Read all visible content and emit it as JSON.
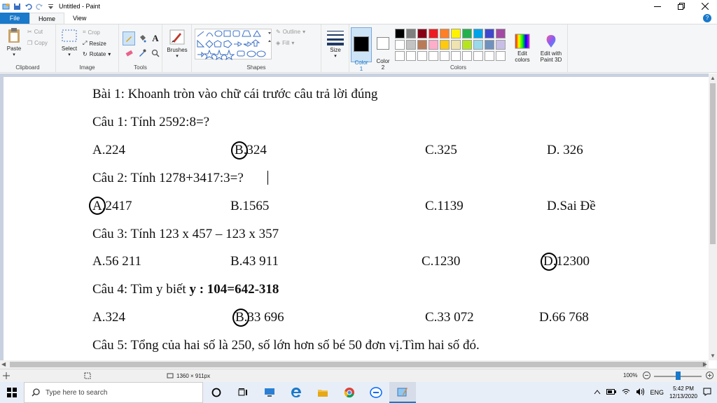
{
  "window": {
    "title": "Untitled - Paint"
  },
  "tabs": [
    "File",
    "Home",
    "View"
  ],
  "ribbon": {
    "clipboard": {
      "label": "Clipboard",
      "paste": "Paste",
      "cut": "Cut",
      "copy": "Copy"
    },
    "image": {
      "label": "Image",
      "select": "Select",
      "crop": "Crop",
      "resize": "Resize",
      "rotate": "Rotate"
    },
    "tools": {
      "label": "Tools"
    },
    "brushes": {
      "label": "Brushes"
    },
    "shapes": {
      "label": "Shapes",
      "outline": "Outline",
      "fill": "Fill"
    },
    "size": {
      "label": "Size"
    },
    "colors": {
      "label": "Colors",
      "color1": "Color\n1",
      "color2": "Color\n2",
      "edit": "Edit\ncolors",
      "paint3d": "Edit with\nPaint 3D",
      "row1": [
        "#000000",
        "#7f7f7f",
        "#880015",
        "#ed1c24",
        "#ff7f27",
        "#fff200",
        "#22b14c",
        "#00a2e8",
        "#3f48cc",
        "#a349a4"
      ],
      "row2": [
        "#ffffff",
        "#c3c3c3",
        "#b97a57",
        "#ffaec9",
        "#ffc90e",
        "#efe4b0",
        "#b5e61d",
        "#99d9ea",
        "#7092be",
        "#c8bfe7"
      ]
    }
  },
  "canvas": {
    "lines": {
      "l1": "Bài 1: Khoanh tròn vào chữ cái trước  câu trả lời đúng",
      "l2": "Câu 1: Tính 2592:8=?",
      "l4": "Câu 2: Tính 1278+3417:3=?",
      "l6": "Câu 3: Tính 123 x 457 – 123 x 357",
      "l8_a": "Câu 4: Tìm y biết ",
      "l8_b": "y : 104=642-318",
      "l10": "Câu 5: Tổng của hai số là 250, số lớn hơn số bé 50 đơn vị.Tìm hai số đó."
    },
    "q1": [
      "A.224",
      "B.324",
      "C.325",
      "D. 326"
    ],
    "q2": [
      "A.2417",
      "B.1565",
      "C.1139",
      "D.Sai Đề"
    ],
    "q3": [
      "A.56 211",
      "B.43 911",
      "C.1230",
      "D.12300"
    ],
    "q4": [
      "A.324",
      "B.33 696",
      "C.33 072",
      "D.66 768"
    ]
  },
  "status": {
    "size": "1360 × 911px",
    "zoom": "100%"
  },
  "taskbar": {
    "search_placeholder": "Type here to search",
    "lang": "ENG",
    "time": "5:42 PM",
    "date": "12/13/2020"
  }
}
